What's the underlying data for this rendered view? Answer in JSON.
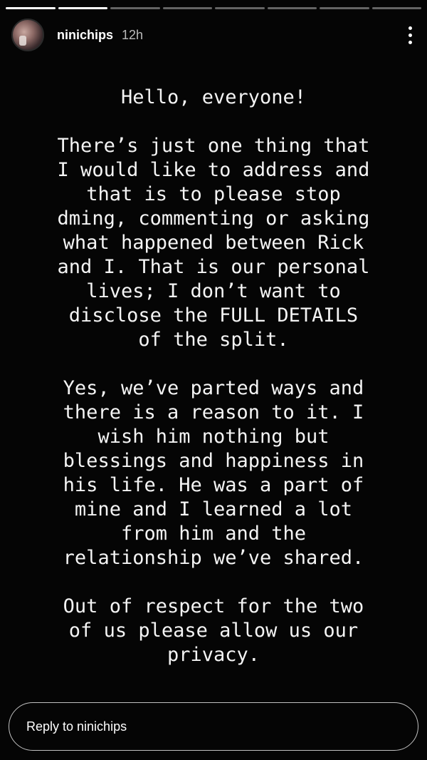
{
  "story": {
    "segments_total": 8,
    "segments_done": 2,
    "header": {
      "username": "ninichips",
      "time": "12h",
      "avatar_icon": "profile-avatar",
      "more_icon": "vertical-dots-icon"
    },
    "paragraphs": [
      "Hello, everyone!",
      "There’s just one thing that\nI would like to address and\nthat is to please stop\ndming, commenting or asking\nwhat happened between Rick\nand I. That is our personal\nlives; I don’t want to\ndisclose the FULL DETAILS\nof the split.",
      "Yes, we’ve parted ways and\nthere is a reason to it. I\nwish him nothing but\nblessings and happiness in\nhis life. He was a part of\nmine and I learned a lot\nfrom him and the\nrelationship we’ve shared.",
      "Out of respect for the two\nof us please allow us our\nprivacy."
    ],
    "reply_placeholder": "Reply to ninichips"
  },
  "colors": {
    "background": "#050505",
    "text": "#f4f4f4",
    "progress_done": "#ffffff",
    "progress_pending": "rgba(255,255,255,0.38)"
  }
}
